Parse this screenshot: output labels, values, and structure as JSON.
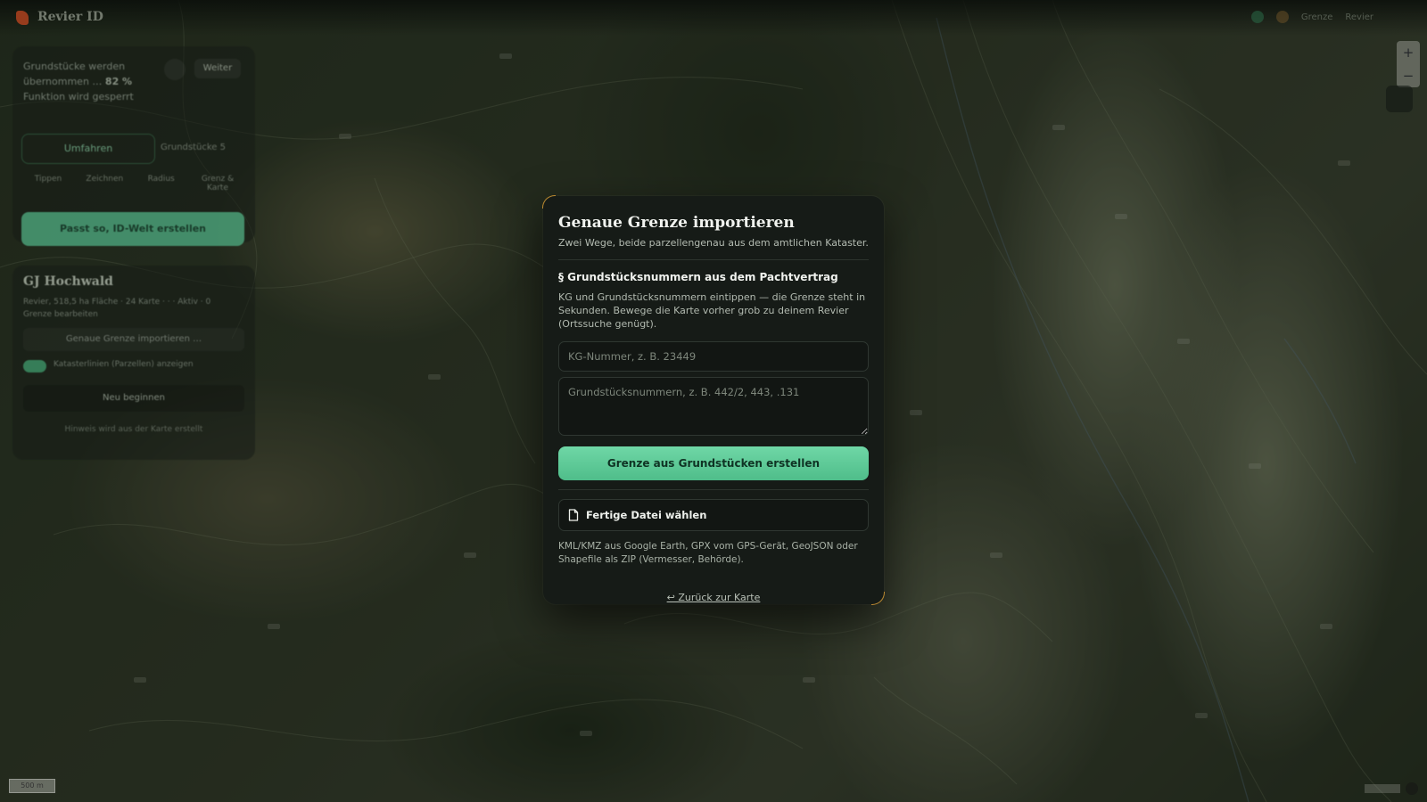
{
  "app": {
    "title": "Revier ID"
  },
  "topbar": {
    "items": [
      "Grenze",
      "Revier"
    ]
  },
  "map": {
    "zoom_in": "+",
    "zoom_out": "−",
    "scale": "500 m"
  },
  "side_panel": {
    "status_line1": "Grundstücke werden",
    "status_line2": "übernommen …",
    "status_percent": "82 %",
    "status_line3": "Funktion wird gesperrt",
    "weiter_label": "Weiter",
    "walk_label": "Umfahren",
    "count_label": "Grundstücke",
    "count_value": "5",
    "tools": [
      "Tippen",
      "Zeichnen",
      "Radius",
      "Grenz & Karte"
    ],
    "fit_label": "Passt so, ID-Welt erstellen"
  },
  "side_card": {
    "title": "GJ Hochwald",
    "meta": "Revier, 518,5 ha Fläche · 24 Karte · · · Aktiv · 0",
    "meta2": "Grenze bearbeiten",
    "import_label": "Genaue Grenze importieren …",
    "toggle_label": "Katasterlinien (Parzellen) anzeigen",
    "restart_label": "Neu beginnen",
    "note": "Hinweis wird aus der Karte erstellt"
  },
  "modal": {
    "title": "Genaue Grenze importieren",
    "subtitle": "Zwei Wege, beide parzellengenau aus dem amtlichen Kataster.",
    "section_title": "§ Grundstücksnummern aus dem Pachtvertrag",
    "section_desc": "KG und Grundstücksnummern eintippen — die Grenze steht in Sekunden. Bewege die Karte vorher grob zu deinem Revier (Ortssuche genügt).",
    "kg_placeholder": "KG-Nummer, z. B. 23449",
    "kg_value": "",
    "parcels_placeholder": "Grundstücksnummern, z. B. 442/2, 443, .131",
    "parcels_value": "",
    "create_button": "Grenze aus Grundstücken erstellen",
    "file_button": "Fertige Datei wählen",
    "file_icon": "document-icon",
    "file_hint": "KML/KMZ aus Google Earth, GPX vom GPS-Gerät, GeoJSON oder Shapefile als ZIP (Vermesser, Behörde).",
    "back_link": "↩ Zurück zur Karte"
  },
  "colors": {
    "accent": "#5fca98",
    "modal_bg": "#161b17",
    "corner_accent": "#b8862f"
  }
}
